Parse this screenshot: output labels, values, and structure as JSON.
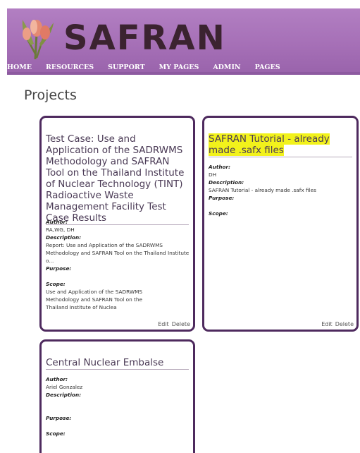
{
  "brand": {
    "logo_text": "SAFRAN"
  },
  "nav": [
    "HOME",
    "RESOURCES",
    "SUPPORT",
    "MY PAGES",
    "ADMIN",
    "PAGES"
  ],
  "page_title": "Projects",
  "labels": {
    "author": "Author:",
    "description": "Description:",
    "purpose": "Purpose:",
    "scope": "Scope:",
    "edit": "Edit",
    "delete": "Delete"
  },
  "projects": [
    {
      "title": "Test Case: Use and Application of the SADRWMS Methodology and SAFRAN Tool on the Thailand Institute of Nuclear Technology (TINT) Radioactive Waste Management Facility Test Case Results",
      "author": "RA,WG, DH",
      "description": "Report: Use and Application of the SADRWMS Methodology and SAFRAN Tool on the Thailand Institute o...",
      "purpose": "",
      "scope": "Use and Application of the SADRWMS Methodology and SAFRAN Tool on the Thailand Institute of Nuclea"
    },
    {
      "title_highlight": "SAFRAN Tutorial - already made .safx files",
      "author": "DH",
      "description": "SAFRAN Tutorial - already made .safx files",
      "purpose": "",
      "scope": ""
    },
    {
      "title": "Central Nuclear Embalse",
      "author": "Ariel Gonzalez",
      "description": "",
      "purpose": "",
      "scope": ""
    }
  ],
  "colors": {
    "header": "#a56fb6",
    "card_border": "#4e2a5e",
    "highlight": "#f2f21b"
  }
}
